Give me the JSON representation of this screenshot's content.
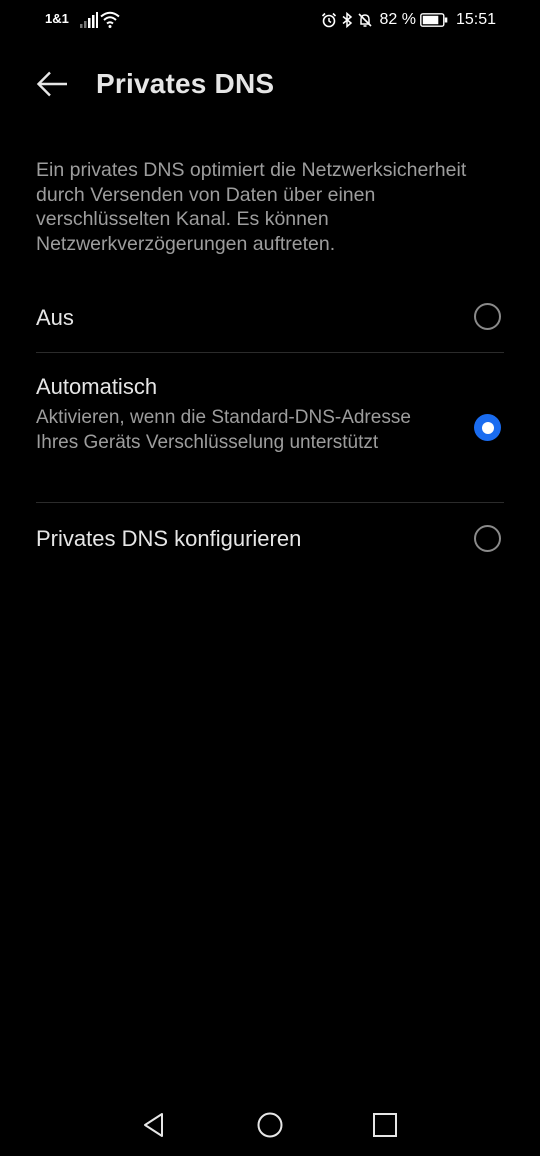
{
  "status_bar": {
    "carrier": "1&1",
    "battery_percent": "82 %",
    "time": "15:51",
    "icons": [
      "signal-icon",
      "wifi-icon",
      "alarm-icon",
      "bluetooth-icon",
      "bell-off-icon",
      "battery-icon"
    ]
  },
  "header": {
    "title": "Privates DNS",
    "back_icon": "arrow-left-icon"
  },
  "description": "Ein privates DNS optimiert die Netzwerksicherheit durch Versenden von Daten über einen verschlüsselten Kanal. Es können Netzwerkverzögerungen auftreten.",
  "options": [
    {
      "label": "Aus",
      "sublabel": "",
      "selected": false
    },
    {
      "label": "Automatisch",
      "sublabel": "Aktivieren, wenn die Standard-DNS-Adresse Ihres Geräts Verschlüsselung unterstützt",
      "selected": true
    },
    {
      "label": "Privates DNS konfigurieren",
      "sublabel": "",
      "selected": false
    }
  ],
  "colors": {
    "background": "#000000",
    "accent": "#1a6cf0",
    "primary_text": "#e6e6e6",
    "secondary_text": "#9d9d9d"
  },
  "nav_bar": {
    "icons": [
      "back-triangle-icon",
      "home-circle-icon",
      "recents-square-icon"
    ]
  }
}
